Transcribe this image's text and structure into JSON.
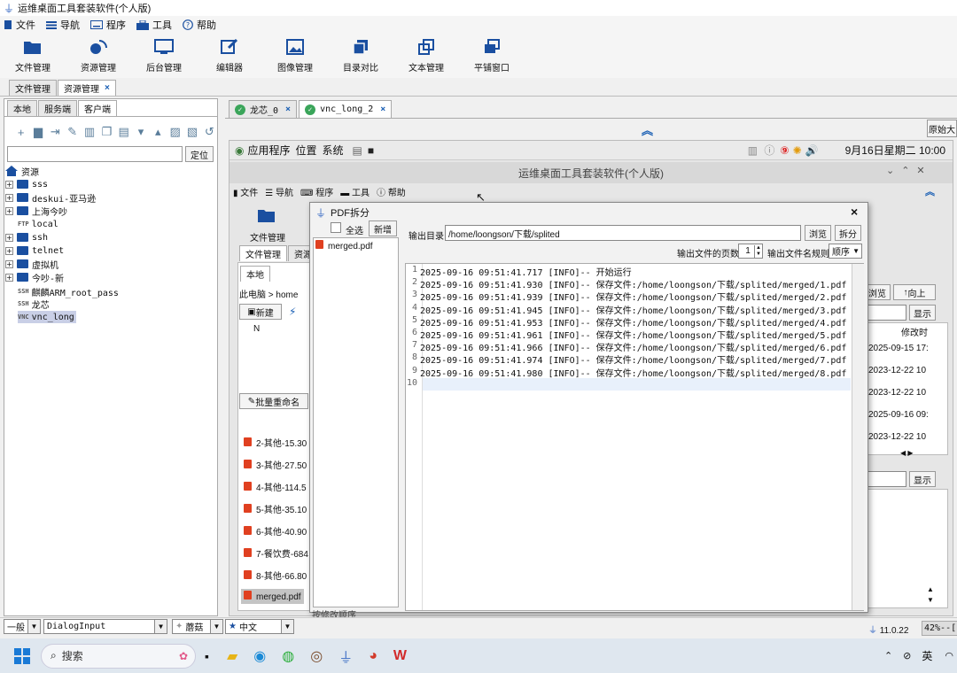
{
  "window": {
    "title": "运维桌面工具套装软件(个人版)"
  },
  "menu": [
    {
      "label": "文件",
      "icon": "file-icon"
    },
    {
      "label": "导航",
      "icon": "list-icon"
    },
    {
      "label": "程序",
      "icon": "keyboard-icon"
    },
    {
      "label": "工具",
      "icon": "toolbox-icon"
    },
    {
      "label": "帮助",
      "icon": "help-icon"
    }
  ],
  "toolbar": [
    {
      "label": "文件管理",
      "icon": "folder-open-icon"
    },
    {
      "label": "资源管理",
      "icon": "satellite-icon"
    },
    {
      "label": "后台管理",
      "icon": "monitor-icon"
    },
    {
      "label": "编辑器",
      "icon": "edit-icon"
    },
    {
      "label": "图像管理",
      "icon": "image-icon"
    },
    {
      "label": "目录对比",
      "icon": "copy-icon"
    },
    {
      "label": "文本管理",
      "icon": "duplicate-icon"
    },
    {
      "label": "平铺窗口",
      "icon": "windows-icon"
    }
  ],
  "main_tabs": [
    {
      "label": "文件管理",
      "active": false
    },
    {
      "label": "资源管理",
      "active": true,
      "close": "×"
    }
  ],
  "left": {
    "tabs": [
      "本地",
      "服务端",
      "客户端"
    ],
    "locate_button": "定位",
    "tree_root": "资源",
    "tree": [
      {
        "label": "sss",
        "kind": "folder"
      },
      {
        "label": "deskui-亚马逊",
        "kind": "folder"
      },
      {
        "label": "上海今吵",
        "kind": "folder"
      },
      {
        "label": "local",
        "kind": "ftp",
        "tag": "FTP"
      },
      {
        "label": "ssh",
        "kind": "folder"
      },
      {
        "label": "telnet",
        "kind": "folder"
      },
      {
        "label": "虚拟机",
        "kind": "folder"
      },
      {
        "label": "今吵-新",
        "kind": "folder"
      },
      {
        "label": "麒麟ARM_root_pass",
        "kind": "ssh",
        "tag": "SSH"
      },
      {
        "label": "龙芯",
        "kind": "ssh",
        "tag": "SSH"
      },
      {
        "label": "vnc_long",
        "kind": "vnc",
        "tag": "VNC",
        "selected": true
      }
    ]
  },
  "right_tabs": [
    {
      "label": "龙芯_0",
      "close": "×"
    },
    {
      "label": "vnc_long_2",
      "close": "×",
      "active": true
    }
  ],
  "right_button": "原始大",
  "remote": {
    "menus": [
      "应用程序",
      "位置",
      "系统"
    ],
    "clock": "9月16日星期二 10:00",
    "title": "运维桌面工具套装软件(个人版)",
    "menu": [
      "文件",
      "导航",
      "程序",
      "工具",
      "帮助"
    ],
    "tool_label": "文件管理",
    "tabs": [
      "文件管理",
      "资源"
    ],
    "sub_tab": "本地",
    "path": "此电脑 > home",
    "new_button": "新建",
    "col_n": "N",
    "rename_button": "批量重命名",
    "files": [
      "2-其他-15.30",
      "3-其他-27.50",
      "4-其他-114.5",
      "5-其他-35.10",
      "6-其他-40.90",
      "7-餐饮费-684",
      "8-其他-66.80",
      "merged.pdf"
    ],
    "right_buttons": {
      "browse": "浏览",
      "up": "向上",
      "show": "显示",
      "show2": "显示"
    },
    "col_modified": "修改时",
    "dates": [
      "2025-09-15 17:",
      "2023-12-22 10",
      "2023-12-22 10",
      "2025-09-16 09:",
      "2023-12-22 10"
    ],
    "bottom_label": "按修改顺序"
  },
  "dialog": {
    "title": "PDF拆分",
    "close": "×",
    "select_all": "全选",
    "add": "新增",
    "files": [
      "merged.pdf"
    ],
    "output_dir_label": "输出目录",
    "output_dir": "/home/loongson/下载/splited",
    "browse": "浏览",
    "split": "拆分",
    "pages_label": "输出文件的页数",
    "pages_value": "1",
    "naming_label": "输出文件名规则",
    "naming_value": "顺序",
    "log": [
      "2025-09-16 09:51:41.717 [INFO]-- 开始运行",
      "2025-09-16 09:51:41.930 [INFO]-- 保存文件:/home/loongson/下载/splited/merged/1.pdf",
      "2025-09-16 09:51:41.939 [INFO]-- 保存文件:/home/loongson/下载/splited/merged/2.pdf",
      "2025-09-16 09:51:41.945 [INFO]-- 保存文件:/home/loongson/下载/splited/merged/3.pdf",
      "2025-09-16 09:51:41.953 [INFO]-- 保存文件:/home/loongson/下载/splited/merged/4.pdf",
      "2025-09-16 09:51:41.961 [INFO]-- 保存文件:/home/loongson/下载/splited/merged/5.pdf",
      "2025-09-16 09:51:41.966 [INFO]-- 保存文件:/home/loongson/下载/splited/merged/6.pdf",
      "2025-09-16 09:51:41.974 [INFO]-- 保存文件:/home/loongson/下载/splited/merged/7.pdf",
      "2025-09-16 09:51:41.980 [INFO]-- 保存文件:/home/loongson/下载/splited/merged/8.pdf",
      ""
    ]
  },
  "bottom": {
    "combo1": "一般",
    "combo2": "DialogInput",
    "combo3": "蘑菇",
    "combo4": "中文",
    "java_version": "11.0.22",
    "memory": "42%--["
  },
  "taskbar": {
    "search": "搜索",
    "ime": "英"
  }
}
